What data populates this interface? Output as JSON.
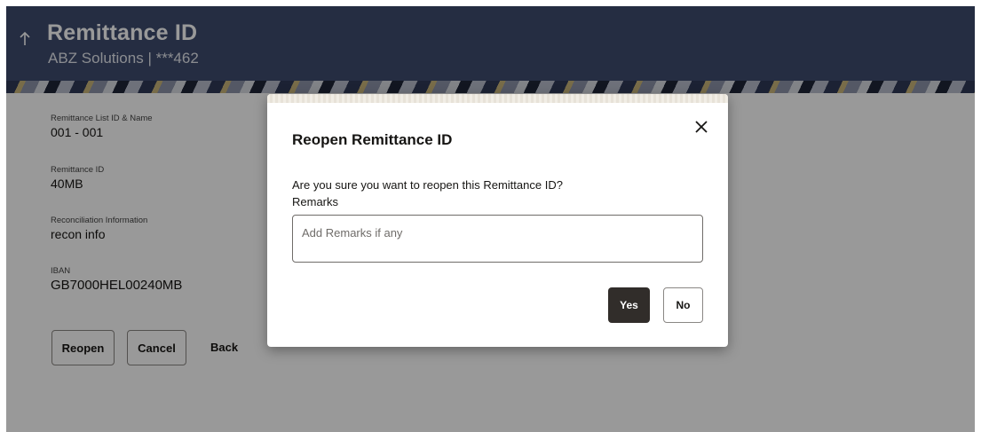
{
  "header": {
    "title": "Remittance ID",
    "subtitle": "ABZ Solutions | ***462",
    "back_icon": "arrow-up-icon"
  },
  "details": {
    "fields": [
      {
        "label": "Remittance List ID & Name",
        "value": "001 - 001"
      },
      {
        "label": "Remittance ID",
        "value": "40MB"
      },
      {
        "label": "Reconciliation Information",
        "value": "recon info"
      },
      {
        "label": "IBAN",
        "value": "GB7000HEL00240MB"
      }
    ],
    "buttons": {
      "reopen": "Reopen",
      "cancel": "Cancel",
      "back": "Back"
    }
  },
  "modal": {
    "title": "Reopen Remittance ID",
    "question": "Are you sure you want to reopen this Remittance ID?",
    "remarks_label": "Remarks",
    "remarks_placeholder": "Add Remarks if any",
    "remarks_value": "",
    "yes_label": "Yes",
    "no_label": "No",
    "close_icon": "close-icon"
  },
  "colors": {
    "header_bg": "#3e4b6e",
    "primary_button": "#312d2a",
    "overlay": "rgba(0,0,0,0.40)"
  }
}
